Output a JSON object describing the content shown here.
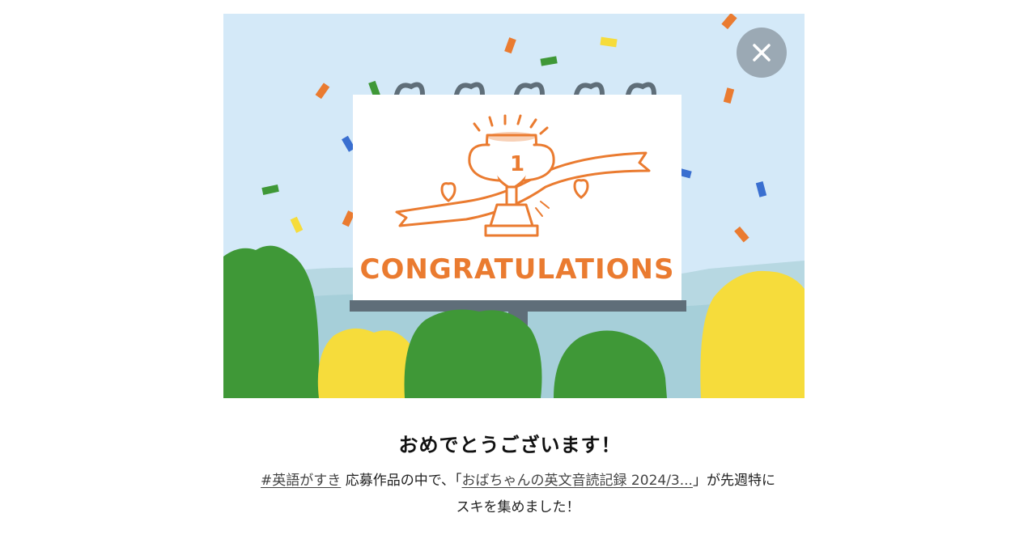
{
  "banner": {
    "congrats_text": "CONGRATULATIONS",
    "trophy_number": "1",
    "colors": {
      "sky": "#d4e9f8",
      "accent": "#ea7b30",
      "tree_green": "#3f9837",
      "tree_yellow": "#f6dc3b",
      "billboard_post": "#5f6e79"
    }
  },
  "close_button": {
    "icon": "close-icon"
  },
  "headline": "おめでとうございます！",
  "message": {
    "hashtag": "#英語がすき",
    "text1": "応募作品の中で、「",
    "article_link": "おばちゃんの英文音読記録 2024/3...",
    "text2": "」が先週特にスキを集めました！"
  }
}
